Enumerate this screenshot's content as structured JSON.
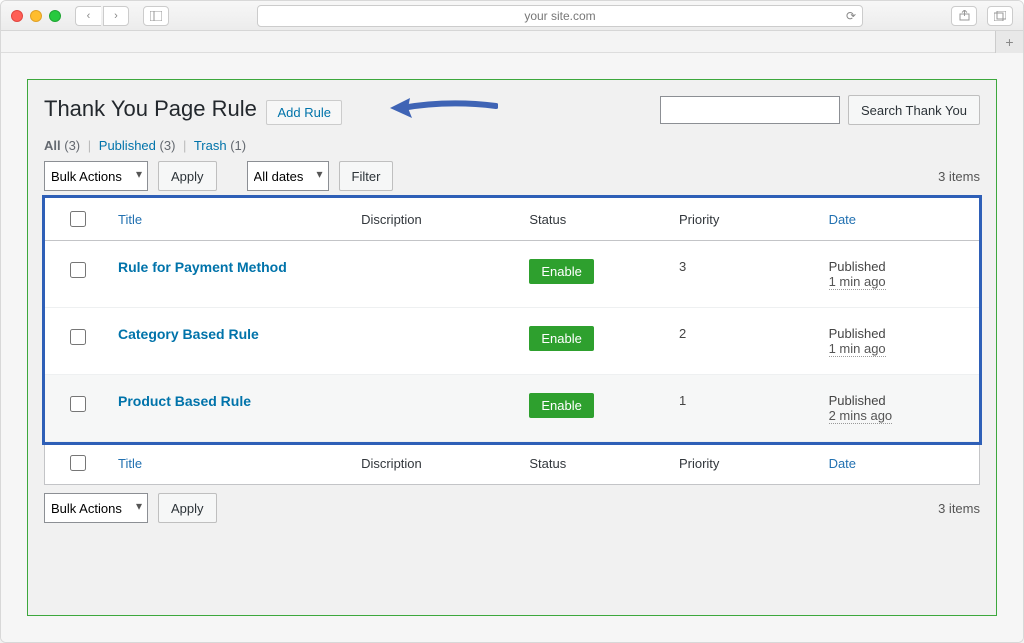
{
  "browser": {
    "url": "your site.com"
  },
  "header": {
    "title": "Thank You Page Rule",
    "add_label": "Add Rule"
  },
  "filters": {
    "all_label": "All",
    "all_count": "(3)",
    "published_label": "Published",
    "published_count": "(3)",
    "trash_label": "Trash",
    "trash_count": "(1)"
  },
  "search": {
    "button": "Search Thank You"
  },
  "bulk": {
    "select": "Bulk Actions",
    "apply": "Apply",
    "dates": "All dates",
    "filter": "Filter",
    "count_top": "3 items",
    "count_bottom": "3 items"
  },
  "columns": {
    "title": "Title",
    "desc": "Discription",
    "status": "Status",
    "priority": "Priority",
    "date": "Date"
  },
  "rows": [
    {
      "title": "Rule for Payment Method",
      "status": "Enable",
      "priority": "3",
      "pub": "Published",
      "ago": "1 min ago"
    },
    {
      "title": "Category Based Rule",
      "status": "Enable",
      "priority": "2",
      "pub": "Published",
      "ago": "1 min ago"
    },
    {
      "title": "Product Based Rule",
      "status": "Enable",
      "priority": "1",
      "pub": "Published",
      "ago": "2 mins ago"
    }
  ]
}
